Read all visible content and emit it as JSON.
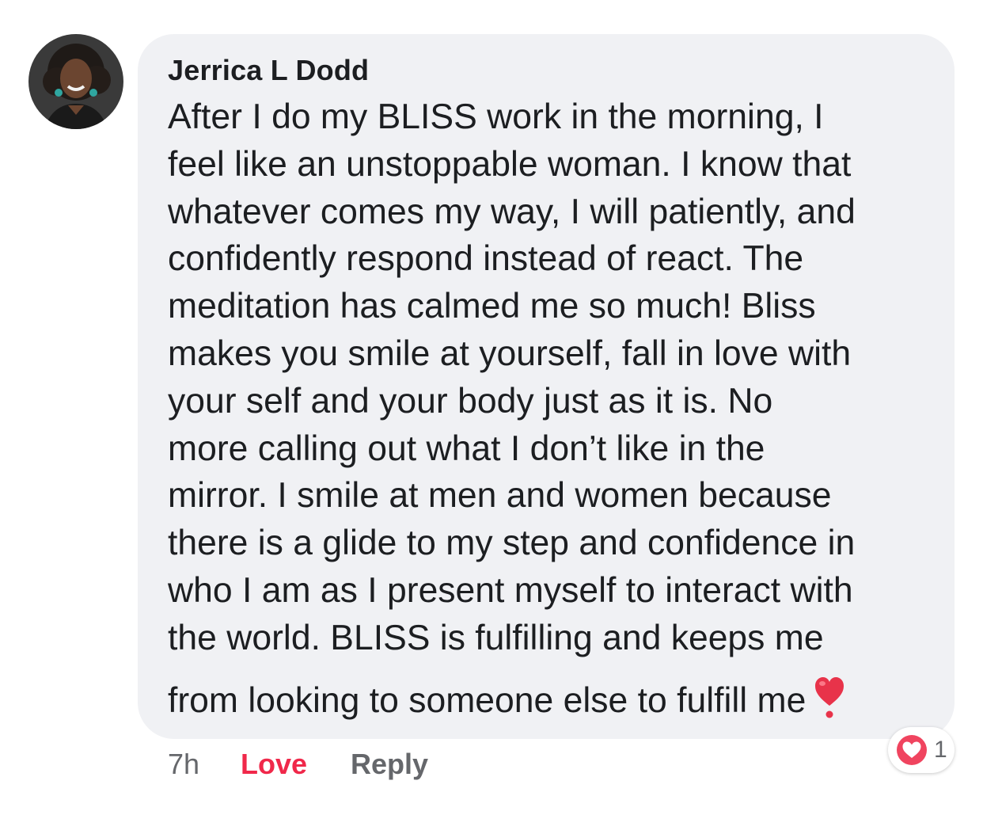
{
  "comment": {
    "author": "Jerrica L Dodd",
    "lines": [
      "After I do my BLISS work in the morning, I",
      "feel like an unstoppable woman. I know that",
      "whatever comes my way, I will patiently, and",
      "confidently respond instead of react. The",
      "meditation has calmed me so much! Bliss",
      "makes you smile at yourself, fall in love with",
      "your self and your body just as it is. No",
      "more calling out what I don’t like in the",
      "mirror. I smile at men and women because",
      "there is a glide to my step and confidence in",
      "who I am as I present myself to interact with",
      "the world. BLISS is fulfilling and keeps me",
      "from looking to someone else to fulfill me"
    ],
    "trailing_emoji": "heart-emoji",
    "time": "7h",
    "love_label": "Love",
    "reply_label": "Reply",
    "reaction": {
      "icon": "love-reaction-icon",
      "count": "1"
    }
  },
  "colors": {
    "bubble_background": "#f0f1f4",
    "text": "#1c1e21",
    "muted": "#65676b",
    "love_accent": "#f0284a",
    "heart": "#e8334a"
  }
}
